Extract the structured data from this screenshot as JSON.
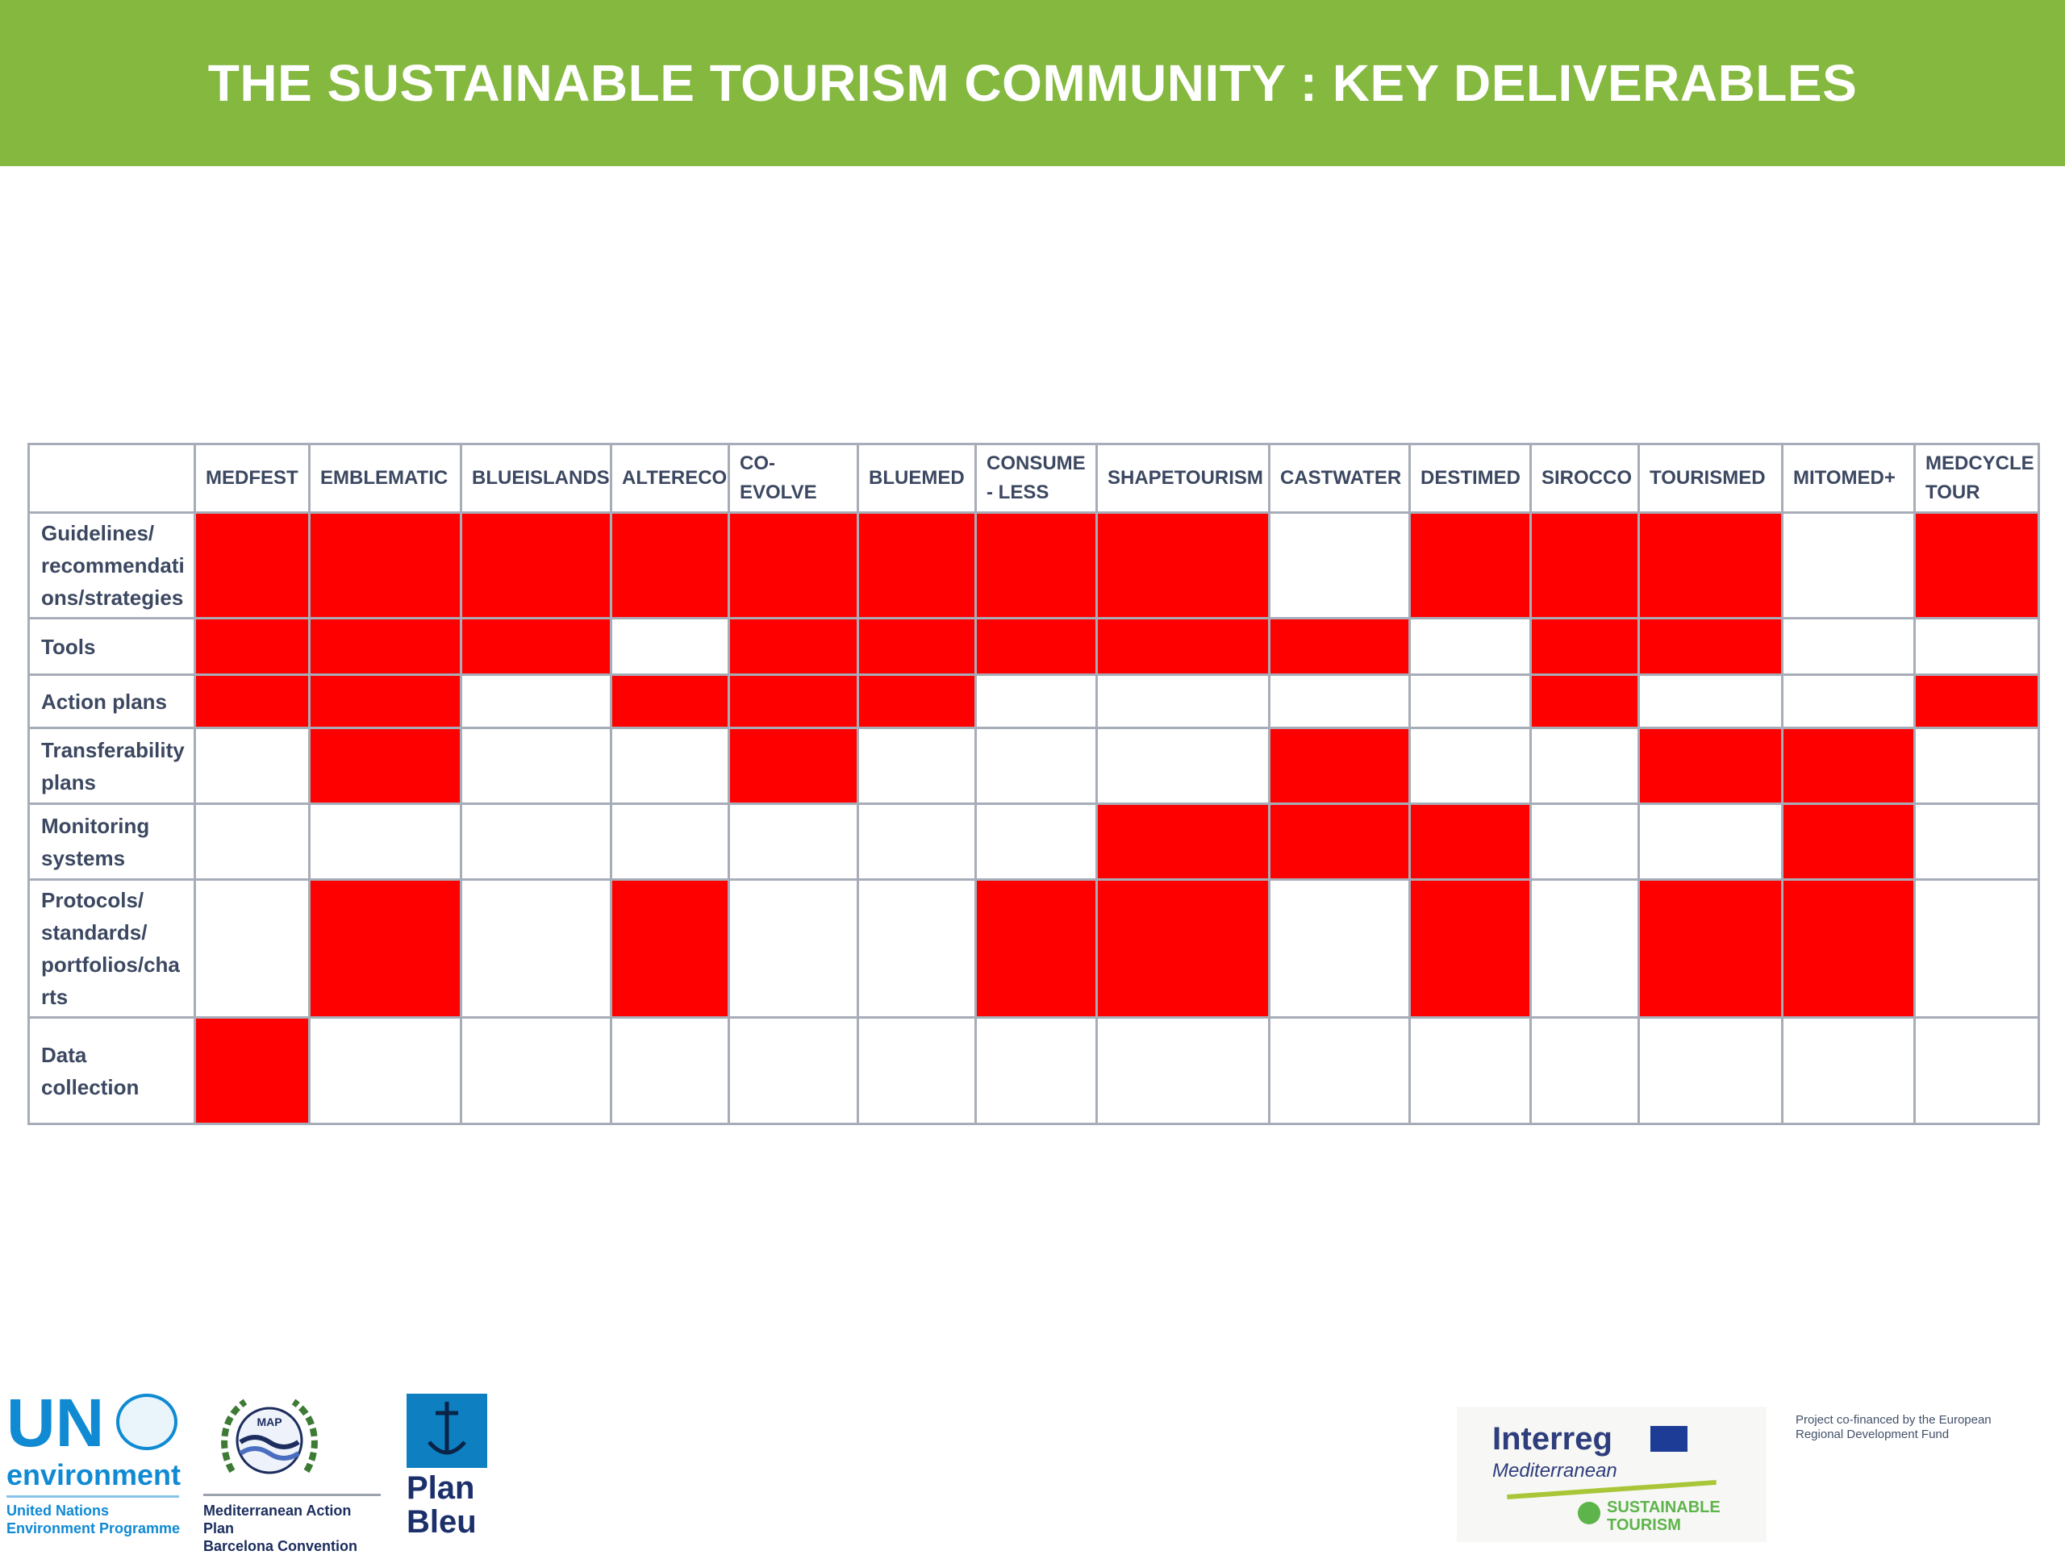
{
  "header": {
    "title": "THE SUSTAINABLE TOURISM COMMUNITY : KEY DELIVERABLES"
  },
  "matrix": {
    "columns": [
      "MEDFEST",
      "EMBLEMATIC",
      "BLUEISLANDS",
      "ALTERECO",
      "CO-EVOLVE",
      "BLUEMED",
      "CONSUME - LESS",
      "SHAPETOURISM",
      "CASTWATER",
      "DESTIMED",
      "SIROCCO",
      "TOURISMED",
      "MITOMED+",
      "MEDCYCLE TOUR"
    ],
    "rows": [
      {
        "label": "Guidelines/ recommendati ons/strategies",
        "marks": [
          1,
          1,
          1,
          1,
          1,
          1,
          1,
          1,
          0,
          1,
          1,
          1,
          0,
          1
        ]
      },
      {
        "label": "Tools",
        "marks": [
          1,
          1,
          1,
          0,
          1,
          1,
          1,
          1,
          1,
          0,
          1,
          1,
          0,
          0
        ]
      },
      {
        "label": "Action plans",
        "marks": [
          1,
          1,
          0,
          1,
          1,
          1,
          0,
          0,
          0,
          0,
          1,
          0,
          0,
          1
        ]
      },
      {
        "label": "Transferability plans",
        "marks": [
          0,
          1,
          0,
          0,
          1,
          0,
          0,
          0,
          1,
          0,
          0,
          1,
          1,
          0
        ]
      },
      {
        "label": "Monitoring systems",
        "marks": [
          0,
          0,
          0,
          0,
          0,
          0,
          0,
          1,
          1,
          1,
          0,
          0,
          1,
          0
        ]
      },
      {
        "label": "Protocols/ standards/ portfolios/cha rts",
        "marks": [
          0,
          1,
          0,
          1,
          0,
          0,
          1,
          1,
          0,
          1,
          0,
          1,
          1,
          0
        ]
      },
      {
        "label": "Data collection",
        "marks": [
          1,
          0,
          0,
          0,
          0,
          0,
          0,
          0,
          0,
          0,
          0,
          0,
          0,
          0
        ]
      }
    ],
    "mark_color": "#ff0000"
  },
  "logos": {
    "unep": {
      "line1": "UN",
      "line2": "environment",
      "sub1": "United Nations",
      "sub2": "Environment Programme"
    },
    "map": {
      "emblem_text": "MAP",
      "sub1": "Mediterranean Action Plan",
      "sub2": "Barcelona Convention"
    },
    "plan_bleu": {
      "line1": "Plan",
      "line2": "Bleu"
    },
    "interreg": {
      "name": "Interreg",
      "region": "Mediterranean",
      "project1": "SUSTAINABLE",
      "project2": "TOURISM"
    }
  },
  "footer": {
    "cofinanced_note": "Project co-financed by the European Regional Development Fund"
  }
}
